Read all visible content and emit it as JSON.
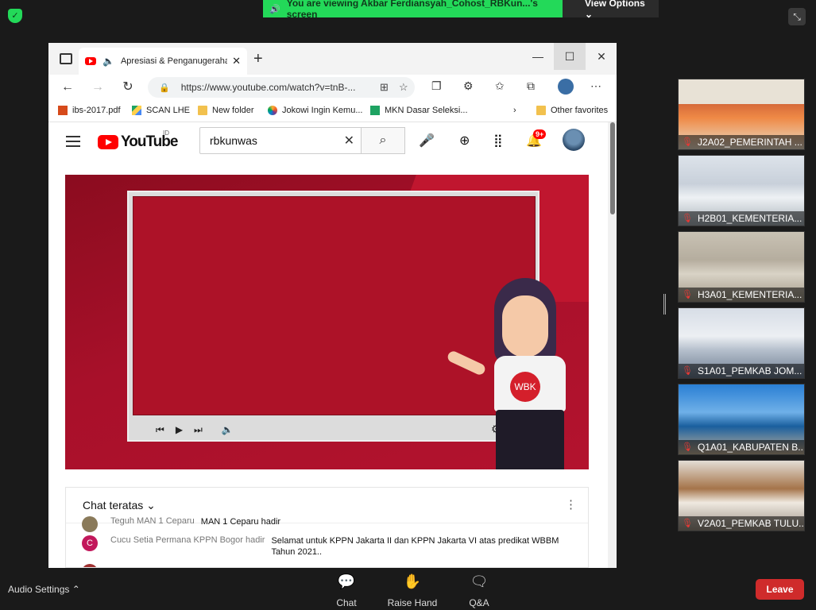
{
  "share_banner": {
    "message": "You are viewing Akbar Ferdiansyah_Cohost_RBKun...'s screen",
    "view_options": "View Options ⌄"
  },
  "browser": {
    "tab_title": "Apresiasi & Penganugerahan",
    "url": "https://www.youtube.com/watch?v=tnB-...",
    "bookmarks": [
      {
        "label": "ibs-2017.pdf",
        "icon": "pdf-icon"
      },
      {
        "label": "SCAN LHE",
        "icon": "drive-icon"
      },
      {
        "label": "New folder",
        "icon": "folder-icon"
      },
      {
        "label": "Jokowi Ingin Kemu...",
        "icon": "nbc-icon"
      },
      {
        "label": "MKN Dasar Seleksi...",
        "icon": "sheets-icon"
      }
    ],
    "other_favorites": "Other favorites"
  },
  "youtube": {
    "logo_text": "YouTube",
    "region": "ID",
    "search_value": "rbkunwas",
    "notification_count": "9+",
    "badge_text": "WBK",
    "chat_header": "Chat teratas ⌄",
    "chat": [
      {
        "author": "Teguh MAN 1 Ceparu",
        "message": "MAN 1 Ceparu hadir",
        "avatar_color": "#8a7a5a",
        "initial": ""
      },
      {
        "author": "Cucu Setia Permana KPPN Bogor hadir",
        "message": "Selamat untuk KPPN Jakarta II dan KPPN Jakarta VI atas predikat WBBM Tahun 2021..",
        "avatar_color": "#c2185b",
        "initial": "C"
      },
      {
        "author": "",
        "message": "",
        "avatar_color": "#a03030",
        "initial": ""
      }
    ]
  },
  "participants": [
    {
      "name": "J2A02_PEMERINTAH ..."
    },
    {
      "name": "H2B01_KEMENTERIA..."
    },
    {
      "name": "H3A01_KEMENTERIA..."
    },
    {
      "name": "S1A01_PEMKAB JOM..."
    },
    {
      "name": "Q1A01_KABUPATEN B..."
    },
    {
      "name": "V2A01_PEMKAB TULU..."
    }
  ],
  "footer": {
    "audio_settings": "Audio Settings ⌃",
    "chat": "Chat",
    "raise_hand": "Raise Hand",
    "qa": "Q&A",
    "leave": "Leave"
  },
  "colors": {
    "banner_green": "#23d959",
    "leave_red": "#cf2b2b",
    "video_red": "#a40f26",
    "youtube_red": "#ff0000"
  }
}
